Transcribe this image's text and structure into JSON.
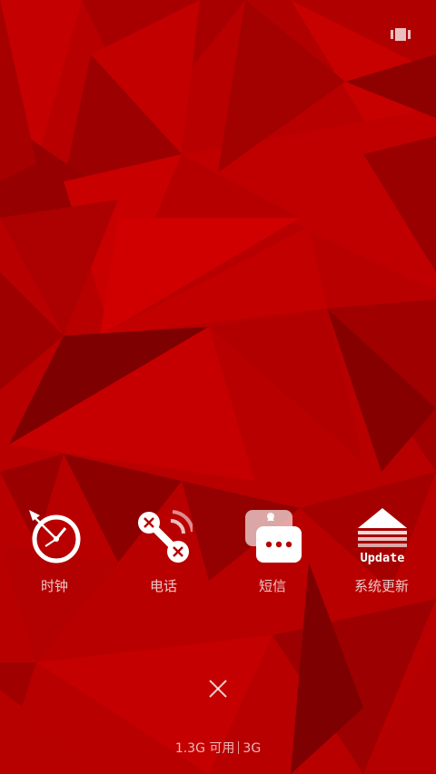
{
  "colors": {
    "background": "#b80000",
    "dark_facet": "#7a0000",
    "light_facet": "#d10000",
    "icon_white": "#ffffff"
  },
  "top_bar": {
    "recents_icon": "recent-apps-icon"
  },
  "apps": [
    {
      "label": "时钟",
      "icon": "clock-icon"
    },
    {
      "label": "电话",
      "icon": "phone-icon"
    },
    {
      "label": "短信",
      "icon": "messages-icon"
    },
    {
      "label": "系统更新",
      "icon": "system-update-icon",
      "icon_text": "Update"
    }
  ],
  "close_button": {
    "icon": "close-icon"
  },
  "memory": {
    "available": "1.3G 可用",
    "total": "3G"
  }
}
